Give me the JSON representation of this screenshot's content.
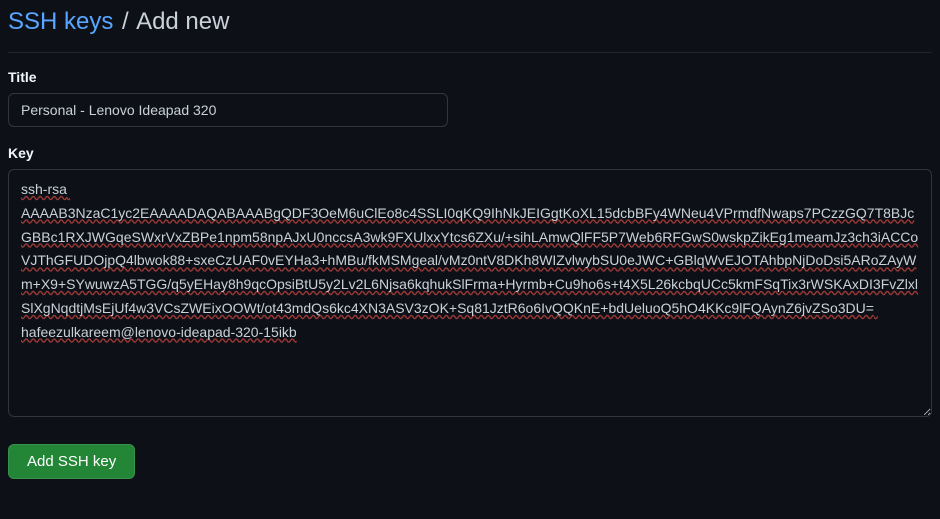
{
  "breadcrumb": {
    "parent": "SSH keys",
    "separator": "/",
    "current": "Add new"
  },
  "form": {
    "title_label": "Title",
    "title_value": "Personal - Lenovo Ideapad 320",
    "key_label": "Key",
    "key_value": "ssh-rsa AAAAB3NzaC1yc2EAAAADAQABAAABgQDF3OeM6uClEo8c4SSLI0qKQ9IhNkJEIGgtKoXL15dcbBFy4WNeu4VPrmdfNwaps7PCzzGQ7T8BJcGBBc1RXJWGqeSWxrVxZBPe1npm58npAJxU0nccsA3wk9FXUlxxYtcs6ZXu/+sihLAmwQlFF5P7Web6RFGwS0wskpZikEg1meamJz3ch3iACCoVJThGFUDOjpQ4lbwok88+sxeCzUAF0vEYHa3+hMBu/fkMSMgeal/vMz0ntV8DKh8WIZvlwybSU0eJWC+GBlqWvEJOTAhbpNjDoDsi5ARoZAyWm+X9+SYwuwzA5TGG/q5yEHay8h9qcOpsiBtU5y2Lv2L6Njsa6kqhukSlFrma+Hyrmb+Cu9ho6s+t4X5L26kcbqUCc5kmFSqTix3rWSKAxDI3FvZlxlSlXgNqdtjMsEjUf4w3VCsZWEixOOWt/ot43mdQs6kc4XN3ASV3zOK+Sq81JztR6o6IvQQKnE+bdUeluoQ5hO4KKc9lFQAynZ6jvZSo3DU= hafeezulkareem@lenovo-ideapad-320-15ikb",
    "submit_label": "Add SSH key"
  }
}
